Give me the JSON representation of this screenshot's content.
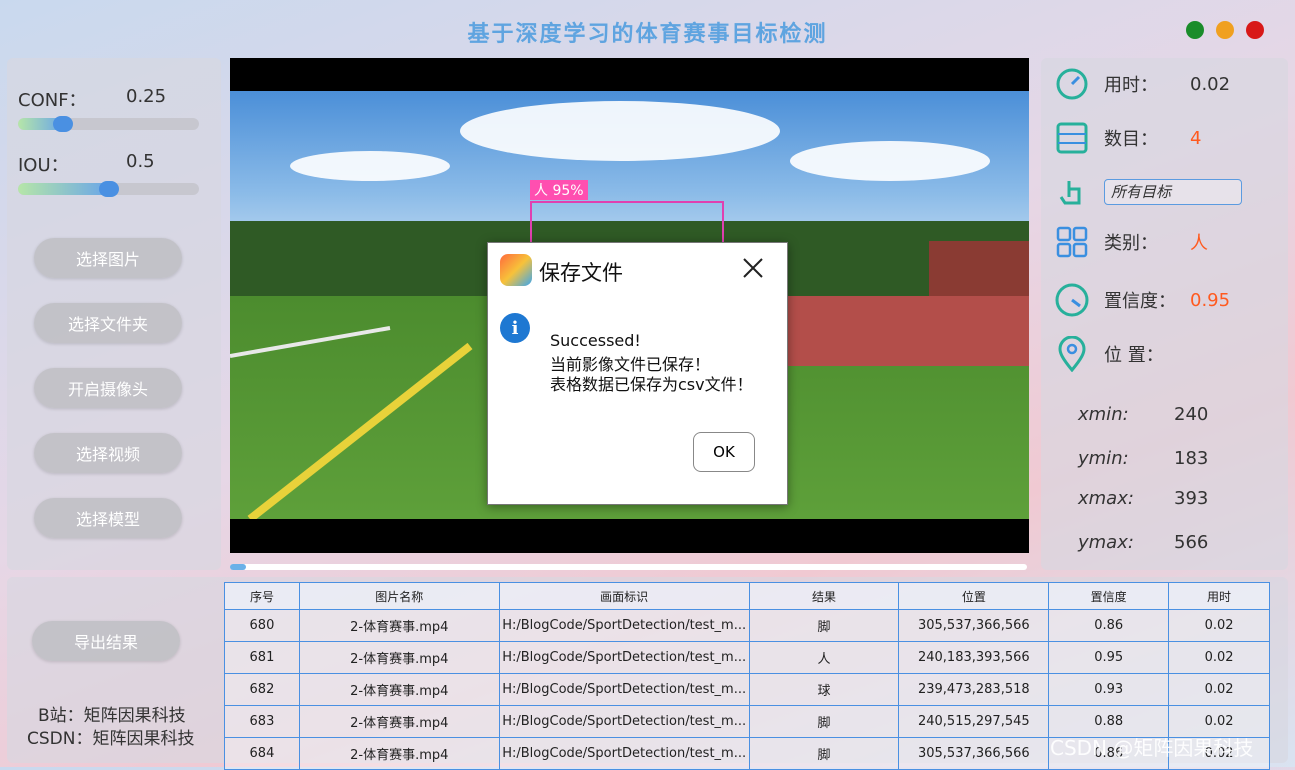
{
  "app": {
    "title": "基于深度学习的体育赛事目标检测"
  },
  "window_controls": {
    "colors": [
      "#1a8c2a",
      "#f0a020",
      "#d81818"
    ],
    "names": [
      "green-button",
      "yellow-button",
      "red-button"
    ]
  },
  "controls": {
    "conf_label": "CONF：",
    "conf_value": "0.25",
    "conf_fraction": 0.25,
    "iou_label": "IOU：",
    "iou_value": "0.5",
    "iou_fraction": 0.5,
    "buttons": [
      "选择图片",
      "选择文件夹",
      "开启摄像头",
      "选择视频",
      "选择模型"
    ],
    "export_button": "导出结果"
  },
  "credits": {
    "line1": "B站：矩阵因果科技",
    "line2": "CSDN：矩阵因果科技"
  },
  "video": {
    "bbox_label": "人 95%",
    "progress_fraction": 0.02
  },
  "dialog": {
    "title": "保存文件",
    "line1": "Successed!",
    "line2": "当前影像文件已保存！",
    "line3": "表格数据已保存为csv文件！",
    "ok_label": "OK"
  },
  "info": {
    "time_label": "用时：",
    "time_value": "0.02",
    "count_label": "数目：",
    "count_value": "4",
    "target_select": "所有目标",
    "class_label": "类别：",
    "class_value": "人",
    "conf_label": "置信度：",
    "conf_value": "0.95",
    "pos_label": "位 置：",
    "xmin_label": "xmin:",
    "xmin_value": "240",
    "ymin_label": "ymin:",
    "ymin_value": "183",
    "xmax_label": "xmax:",
    "xmax_value": "393",
    "ymax_label": "ymax:",
    "ymax_value": "566",
    "accent_color": "#ff5a1f"
  },
  "table": {
    "headers": [
      "序号",
      "图片名称",
      "画面标识",
      "结果",
      "位置",
      "置信度",
      "用时"
    ],
    "rows": [
      [
        "680",
        "2-体育赛事.mp4",
        "H:/BlogCode/SportDetection/test_m...",
        "脚",
        "305,537,366,566",
        "0.86",
        "0.02"
      ],
      [
        "681",
        "2-体育赛事.mp4",
        "H:/BlogCode/SportDetection/test_m...",
        "人",
        "240,183,393,566",
        "0.95",
        "0.02"
      ],
      [
        "682",
        "2-体育赛事.mp4",
        "H:/BlogCode/SportDetection/test_m...",
        "球",
        "239,473,283,518",
        "0.93",
        "0.02"
      ],
      [
        "683",
        "2-体育赛事.mp4",
        "H:/BlogCode/SportDetection/test_m...",
        "脚",
        "240,515,297,545",
        "0.88",
        "0.02"
      ],
      [
        "684",
        "2-体育赛事.mp4",
        "H:/BlogCode/SportDetection/test_m...",
        "脚",
        "305,537,366,566",
        "0.86",
        "0.02"
      ]
    ]
  },
  "watermark": "CSDN @矩阵因果科技"
}
